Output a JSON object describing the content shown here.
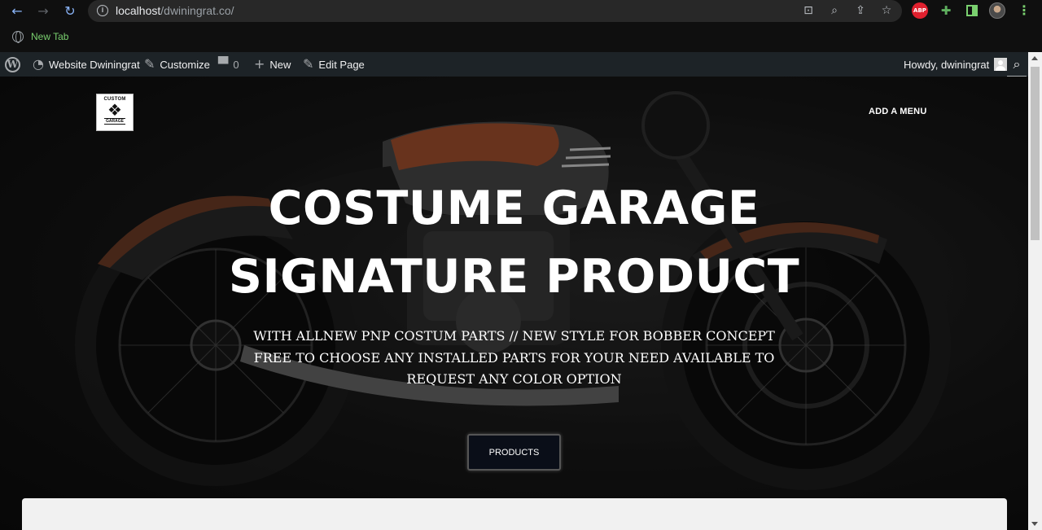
{
  "browser": {
    "url_host": "localhost",
    "url_path": "/dwiningrat.co/",
    "bookmarks": [
      {
        "label": "New Tab"
      }
    ],
    "extensions": {
      "abp": "ABP"
    }
  },
  "adminbar": {
    "site_name": "Website Dwiningrat",
    "customize": "Customize",
    "comments_count": "0",
    "new": "New",
    "edit_page": "Edit Page",
    "howdy": "Howdy, dwiningrat"
  },
  "header": {
    "logo_top": "CUSTOM",
    "logo_bottom": "GARAGE",
    "menu_link": "ADD A MENU"
  },
  "hero": {
    "title_line1": "COSTUME GARAGE",
    "title_line2": "SIGNATURE PRODUCT",
    "subtitle": "WITH ALLNEW PNP COSTUM PARTS // NEW STYLE FOR BOBBER CONCEPT FREE TO CHOOSE ANY INSTALLED PARTS FOR YOUR NEED AVAILABLE TO REQUEST ANY COLOR OPTION",
    "cta": "PRODUCTS"
  },
  "colors": {
    "accent_green": "#7ad06f",
    "adminbar_bg": "#1d2327",
    "bike_accent": "#b8552c"
  }
}
